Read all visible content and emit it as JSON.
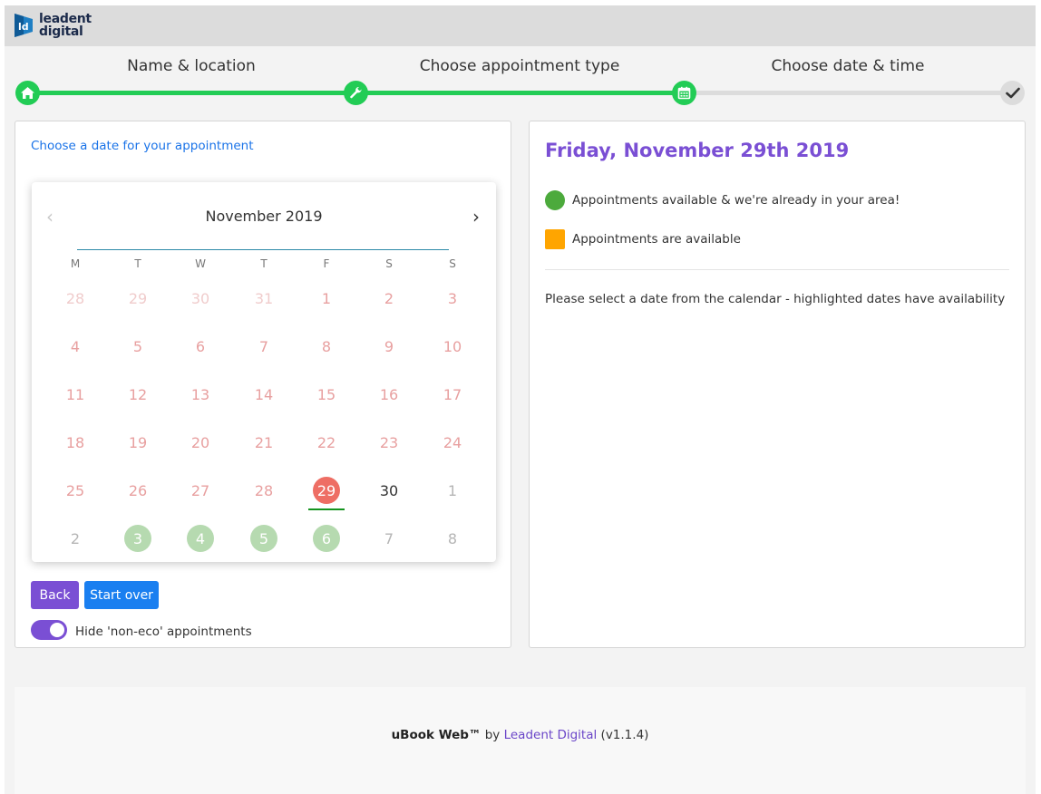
{
  "brand": {
    "logo_mark": "ld",
    "line1": "leadent",
    "line2": "digital"
  },
  "steps": [
    {
      "label": "Name & location",
      "icon": "home-icon",
      "state": "done"
    },
    {
      "label": "Choose appointment type",
      "icon": "wrench-icon",
      "state": "done"
    },
    {
      "label": "Choose date & time",
      "icon": "calendar-icon",
      "state": "current"
    },
    {
      "label": "",
      "icon": "check-icon",
      "state": "todo"
    }
  ],
  "left": {
    "choose_label": "Choose a date for your appointment",
    "back_label": "Back",
    "start_over_label": "Start over",
    "toggle_label": "Hide 'non-eco' appointments",
    "toggle_on": true
  },
  "calendar": {
    "prev_icon": "‹",
    "next_icon": "›",
    "month_title": "November 2019",
    "weekdays": [
      "M",
      "T",
      "W",
      "T",
      "F",
      "S",
      "S"
    ],
    "weeks": [
      [
        {
          "d": "28",
          "s": "prev"
        },
        {
          "d": "29",
          "s": "prev"
        },
        {
          "d": "30",
          "s": "prev"
        },
        {
          "d": "31",
          "s": "prev"
        },
        {
          "d": "1",
          "s": "past"
        },
        {
          "d": "2",
          "s": "past"
        },
        {
          "d": "3",
          "s": "past"
        }
      ],
      [
        {
          "d": "4",
          "s": "past"
        },
        {
          "d": "5",
          "s": "past"
        },
        {
          "d": "6",
          "s": "past"
        },
        {
          "d": "7",
          "s": "past"
        },
        {
          "d": "8",
          "s": "past"
        },
        {
          "d": "9",
          "s": "past"
        },
        {
          "d": "10",
          "s": "past"
        }
      ],
      [
        {
          "d": "11",
          "s": "past"
        },
        {
          "d": "12",
          "s": "past"
        },
        {
          "d": "13",
          "s": "past"
        },
        {
          "d": "14",
          "s": "past"
        },
        {
          "d": "15",
          "s": "past"
        },
        {
          "d": "16",
          "s": "past"
        },
        {
          "d": "17",
          "s": "past"
        }
      ],
      [
        {
          "d": "18",
          "s": "past"
        },
        {
          "d": "19",
          "s": "past"
        },
        {
          "d": "20",
          "s": "past"
        },
        {
          "d": "21",
          "s": "past"
        },
        {
          "d": "22",
          "s": "past"
        },
        {
          "d": "23",
          "s": "past"
        },
        {
          "d": "24",
          "s": "past"
        }
      ],
      [
        {
          "d": "25",
          "s": "past"
        },
        {
          "d": "26",
          "s": "past"
        },
        {
          "d": "27",
          "s": "past"
        },
        {
          "d": "28",
          "s": "past"
        },
        {
          "d": "29",
          "s": "sel"
        },
        {
          "d": "30",
          "s": "normal"
        },
        {
          "d": "1",
          "s": "other"
        }
      ],
      [
        {
          "d": "2",
          "s": "other"
        },
        {
          "d": "3",
          "s": "avail"
        },
        {
          "d": "4",
          "s": "avail"
        },
        {
          "d": "5",
          "s": "avail"
        },
        {
          "d": "6",
          "s": "avail"
        },
        {
          "d": "7",
          "s": "other"
        },
        {
          "d": "8",
          "s": "other"
        }
      ]
    ],
    "colors": {
      "available": "#b6dab0",
      "selected": "#ee6e64",
      "today_underline": "#15941f"
    }
  },
  "right": {
    "selected_date": "Friday, November 29th 2019",
    "legend": [
      {
        "text": "Appointments available & we're already in your area!",
        "color": "#4caa3c",
        "shape": "circle"
      },
      {
        "text": "Appointments are available",
        "color": "#ffa500",
        "shape": "square"
      }
    ],
    "hint": "Please select a date from the calendar - highlighted dates have availability"
  },
  "footer": {
    "product": "uBook Web™",
    "by": "by",
    "company": "Leadent Digital",
    "version": "(v1.1.4)"
  },
  "colors": {
    "progress": "#22cc55",
    "accent": "#7a4fd4",
    "primary": "#1a7ff0"
  }
}
